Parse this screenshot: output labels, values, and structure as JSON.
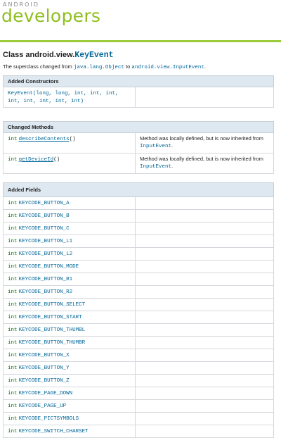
{
  "header": {
    "logo_small": "ANDROID",
    "logo_big": "developers"
  },
  "class_title": {
    "prefix": "Class android.view.",
    "class_name": "KeyEvent"
  },
  "superclass": {
    "text_before": "The superclass changed from ",
    "old": "java.lang.Object",
    "text_middle": " to ",
    "new": "android.view.InputEvent",
    "text_after": "."
  },
  "constructors": {
    "heading": "Added Constructors",
    "rows": [
      {
        "name": "KeyEvent",
        "params_line1": "(long, long, int, int, int,",
        "params_line2": "int, int, int, int, int)"
      }
    ]
  },
  "changed_methods": {
    "heading": "Changed Methods",
    "rows": [
      {
        "type": "int",
        "name": "describeContents",
        "suffix": "()",
        "desc_text": "Method was locally defined, but is now inherited from ",
        "desc_link": "InputEvent",
        "desc_end": "."
      },
      {
        "type": "int",
        "name": "getDeviceId",
        "suffix": "()",
        "desc_text": "Method was locally defined, but is now inherited from ",
        "desc_link": "InputEvent",
        "desc_end": "."
      }
    ]
  },
  "added_fields": {
    "heading": "Added Fields",
    "type": "int",
    "rows": [
      "KEYCODE_BUTTON_A",
      "KEYCODE_BUTTON_B",
      "KEYCODE_BUTTON_C",
      "KEYCODE_BUTTON_L1",
      "KEYCODE_BUTTON_L2",
      "KEYCODE_BUTTON_MODE",
      "KEYCODE_BUTTON_R1",
      "KEYCODE_BUTTON_R2",
      "KEYCODE_BUTTON_SELECT",
      "KEYCODE_BUTTON_START",
      "KEYCODE_BUTTON_THUMBL",
      "KEYCODE_BUTTON_THUMBR",
      "KEYCODE_BUTTON_X",
      "KEYCODE_BUTTON_Y",
      "KEYCODE_BUTTON_Z",
      "KEYCODE_PAGE_DOWN",
      "KEYCODE_PAGE_UP",
      "KEYCODE_PICTSYMBOLS",
      "KEYCODE_SWITCH_CHARSET"
    ]
  }
}
